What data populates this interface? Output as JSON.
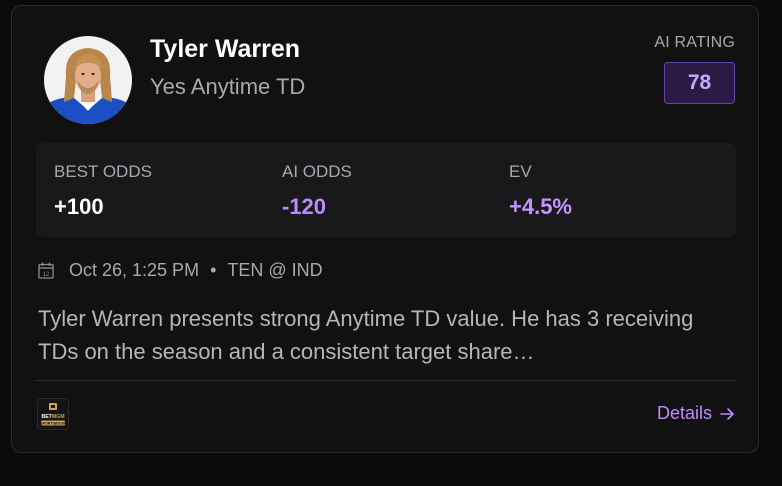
{
  "player": {
    "name": "Tyler Warren",
    "market": "Yes Anytime TD"
  },
  "rating": {
    "label": "AI RATING",
    "value": "78"
  },
  "odds": [
    {
      "label": "BEST ODDS",
      "value": "+100",
      "color": "#ffffff"
    },
    {
      "label": "AI ODDS",
      "value": "-120",
      "color": "#b98bff"
    },
    {
      "label": "EV",
      "value": "+4.5%",
      "color": "#c593ff"
    }
  ],
  "game": {
    "datetime": "Oct 26, 1:25 PM",
    "separator": "•",
    "matchup": "TEN @ IND",
    "icon": "calendar-icon"
  },
  "summary": "Tyler Warren presents strong Anytime TD value. He has 3 receiving TDs on the season and a consistent target share…",
  "sportsbook": {
    "name": "BETMGM",
    "sub": "SPORTSBOOK",
    "icon": "betmgm-logo"
  },
  "details": {
    "label": "Details",
    "icon": "arrow-right-icon"
  },
  "colors": {
    "accent": "#c08bff",
    "badge_bg": "#2b1b44",
    "badge_border": "#6a3fb0"
  }
}
